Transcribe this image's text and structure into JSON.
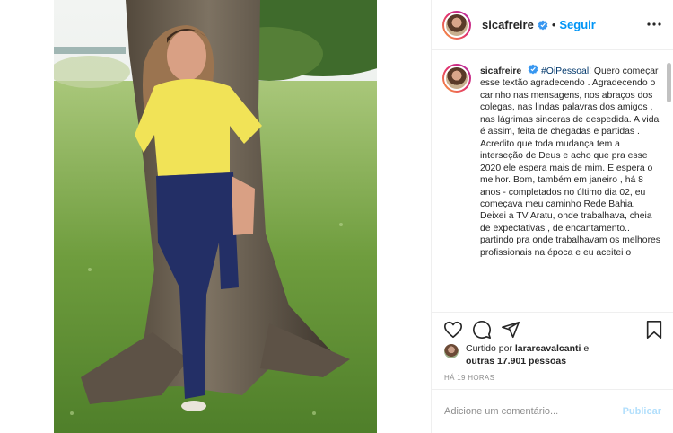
{
  "post": {
    "username": "sicafreire",
    "verified": true,
    "separator": "•",
    "follow_label": "Seguir",
    "more_icon": "more-options-icon"
  },
  "caption": {
    "username": "sicafreire",
    "hashtag": "#OiPessoal",
    "body": "! Quero começar esse textão agradecendo . Agradecendo o carinho nas mensagens, nos abraços dos colegas, nas lindas palavras dos amigos , nas lágrimas sinceras de despedida. A vida é assim, feita de chegadas e partidas . Acredito que toda mudança tem a interseção de Deus e acho que pra esse 2020 ele espera mais de mim. E espera o melhor. Bom, também em janeiro , há 8 anos - completados no último dia 02, eu começava meu caminho Rede Bahia. Deixei a TV Aratu, onde trabalhava, cheia de expectativas , de encantamento.. partindo pra onde trabalhavam os melhores profissionais na época e eu aceitei o"
  },
  "actions": {
    "icons": [
      "heart-icon",
      "comment-icon",
      "share-icon",
      "save-icon"
    ]
  },
  "likes": {
    "prefix": "Curtido por ",
    "liker": "lararcavalcanti",
    "and": " e",
    "others": "outras 17.901 pessoas"
  },
  "timestamp": "HÁ 19 HORAS",
  "comment": {
    "placeholder": "Adicione um comentário...",
    "post_label": "Publicar"
  },
  "colors": {
    "accent": "#0095f6",
    "hashtag": "#00376b",
    "muted": "#8e8e8e",
    "post_disabled": "#b2dffc"
  }
}
